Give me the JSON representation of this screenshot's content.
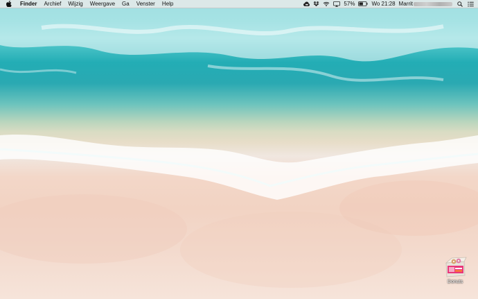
{
  "menubar": {
    "apple_icon": "apple-logo-icon",
    "app_name": "Finder",
    "menus": [
      "Archief",
      "Wijzig",
      "Weergave",
      "Ga",
      "Venster",
      "Help"
    ],
    "status_icons": [
      "creative-cloud-icon",
      "dropbox-icon",
      "wifi-icon",
      "airplay-display-icon"
    ],
    "battery_percent": "57%",
    "battery_level": 0.57,
    "clock": "Wo 21:28",
    "user_name": "Marrit",
    "right_icons": [
      "spotlight-search-icon",
      "notification-center-icon"
    ]
  },
  "desktop": {
    "icons": [
      {
        "label": "Donuts",
        "icon": "donut-box-icon"
      }
    ]
  }
}
